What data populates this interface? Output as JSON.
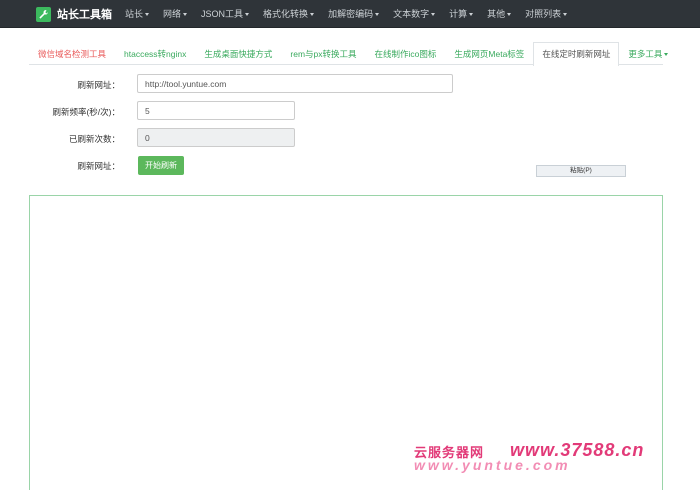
{
  "brand": {
    "title": "站长工具箱",
    "icon": "wrench-icon"
  },
  "nav": [
    {
      "label": "站长",
      "dropdown": true
    },
    {
      "label": "网络",
      "dropdown": true
    },
    {
      "label": "JSON工具",
      "dropdown": true
    },
    {
      "label": "格式化转换",
      "dropdown": true
    },
    {
      "label": "加解密编码",
      "dropdown": true
    },
    {
      "label": "文本数字",
      "dropdown": true
    },
    {
      "label": "计算",
      "dropdown": true
    },
    {
      "label": "其他",
      "dropdown": true
    },
    {
      "label": "对照列表",
      "dropdown": true
    }
  ],
  "tabs": [
    {
      "label": "微信域名检测工具"
    },
    {
      "label": "htaccess转nginx"
    },
    {
      "label": "生成桌面快捷方式"
    },
    {
      "label": "rem与px转换工具"
    },
    {
      "label": "在线制作ico图标"
    },
    {
      "label": "生成网页Meta标签"
    },
    {
      "label": "在线定时刷新网址"
    },
    {
      "label": "更多工具"
    }
  ],
  "form": {
    "url_label": "刷新网址：",
    "url_value": "http://tool.yuntue.com",
    "freq_label": "刷新频率(秒/次)：",
    "freq_value": "5",
    "count_label": "已刷新次数：",
    "count_value": "0",
    "action_label": "刷新网址：",
    "start_button": "开始刷新",
    "paste_button": "粘贴(P)"
  },
  "watermark": {
    "cn": "云服务器网",
    "url": "www.37588.cn",
    "sub": "www.yuntue.com"
  },
  "colors": {
    "navbar": "#2f3439",
    "accent": "#3cb95e",
    "link": "#3aaa5e",
    "first_tab": "#e95a5a",
    "watermark": "#e23a78"
  }
}
